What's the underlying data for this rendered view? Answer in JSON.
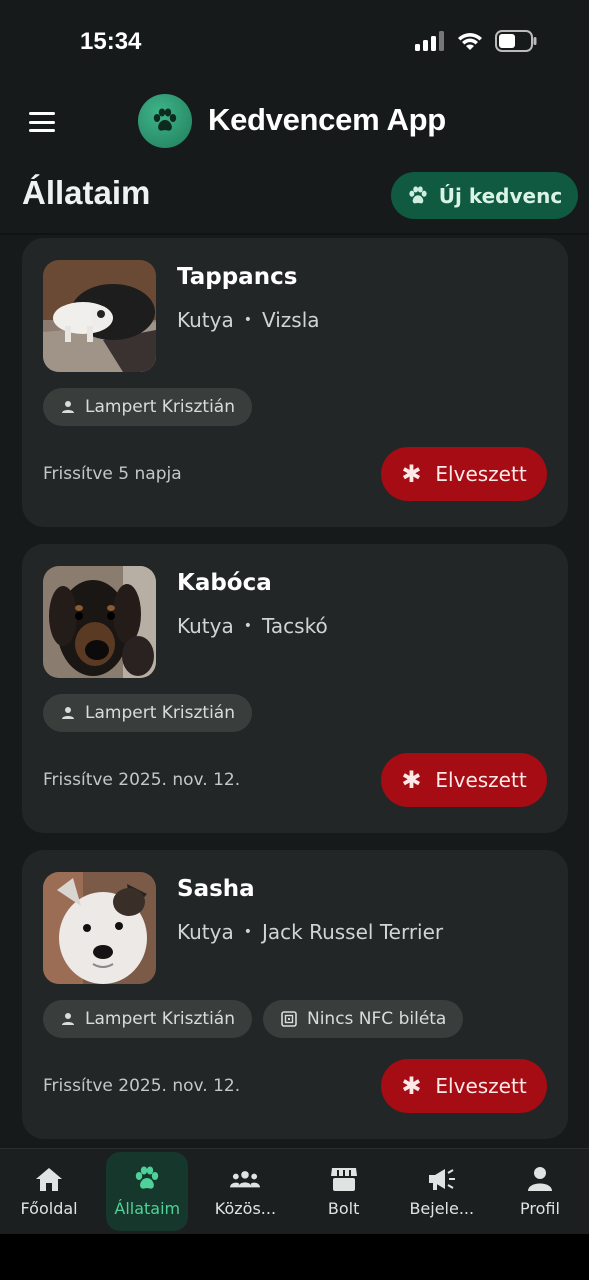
{
  "status_bar": {
    "time": "15:34"
  },
  "header": {
    "app_title": "Kedvencem App"
  },
  "page": {
    "title": "Állataim",
    "new_pet_label": "Új kedvenc"
  },
  "pets": [
    {
      "name": "Tappancs",
      "species": "Kutya",
      "breed": "Vizsla",
      "owner": "Lampert Krisztián",
      "nfc": null,
      "updated": "Frissítve 5 napja",
      "lost_label": "Elveszett"
    },
    {
      "name": "Kabóca",
      "species": "Kutya",
      "breed": "Tacskó",
      "owner": "Lampert Krisztián",
      "nfc": null,
      "updated": "Frissítve 2025. nov. 12.",
      "lost_label": "Elveszett"
    },
    {
      "name": "Sasha",
      "species": "Kutya",
      "breed": "Jack Russel Terrier",
      "owner": "Lampert Krisztián",
      "nfc": "Nincs NFC biléta",
      "updated": "Frissítve 2025. nov. 12.",
      "lost_label": "Elveszett"
    }
  ],
  "nav": {
    "items": [
      {
        "label": "Főoldal",
        "icon": "home-icon"
      },
      {
        "label": "Állataim",
        "icon": "paw-icon",
        "active": true
      },
      {
        "label": "Közös...",
        "icon": "group-icon"
      },
      {
        "label": "Bolt",
        "icon": "store-icon"
      },
      {
        "label": "Bejele...",
        "icon": "megaphone-icon"
      },
      {
        "label": "Profil",
        "icon": "person-icon"
      }
    ]
  },
  "colors": {
    "accent": "#4fd19a",
    "primary_button": "#0f5a40",
    "danger": "#a50c14",
    "background": "#171a1a",
    "card": "#222626"
  }
}
